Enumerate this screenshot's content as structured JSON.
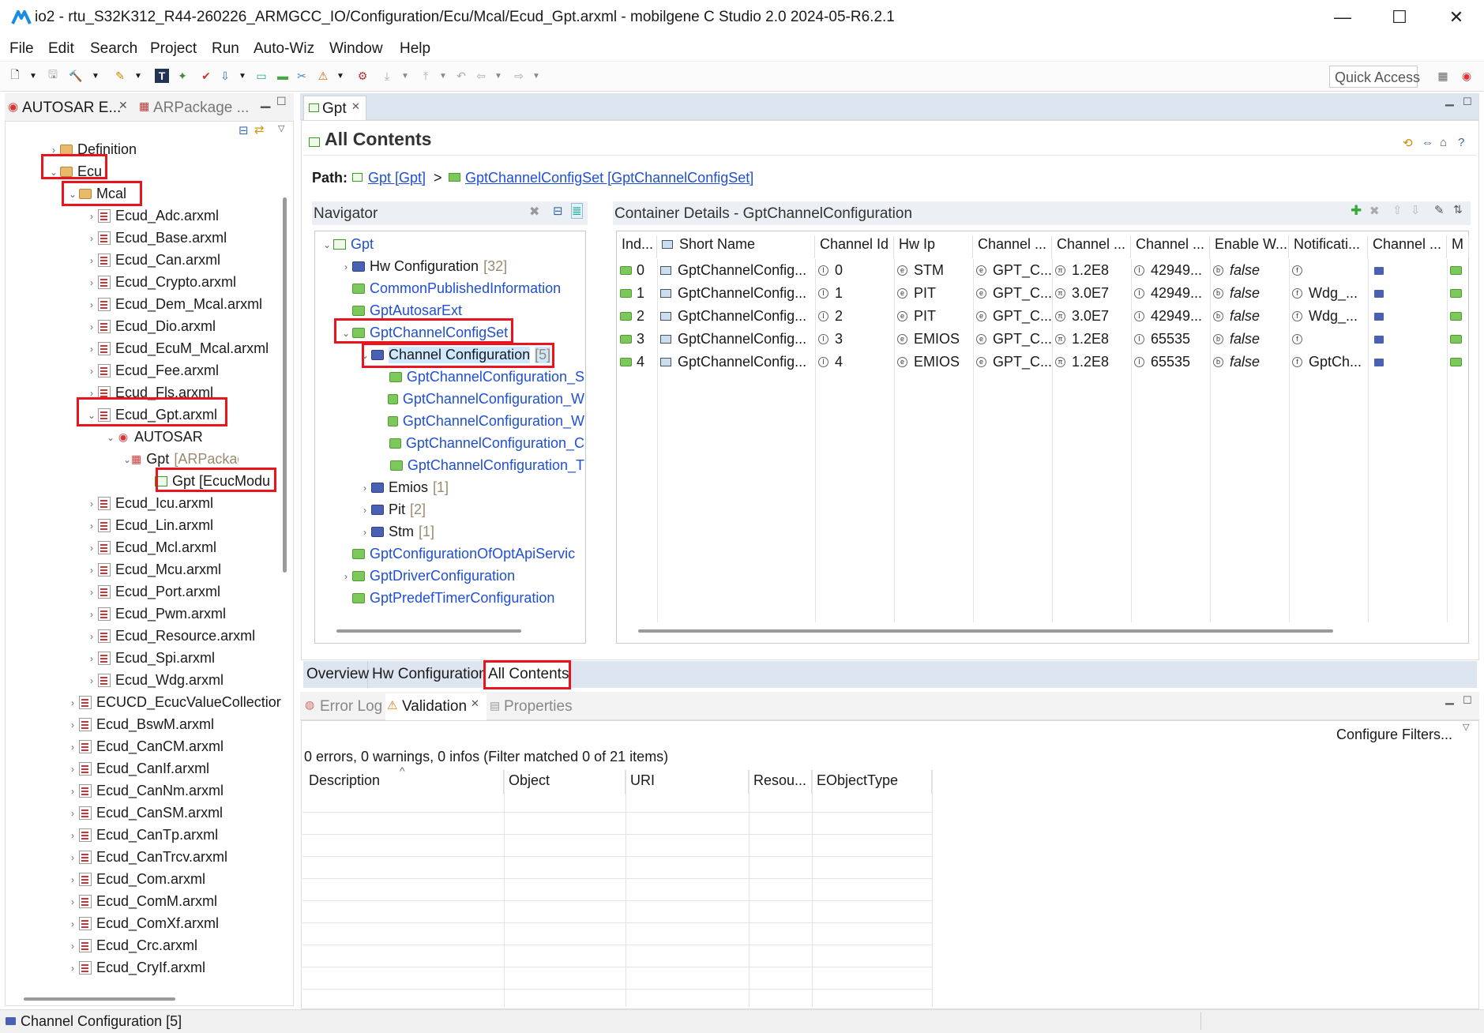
{
  "window": {
    "title": "io2 - rtu_S32K312_R44-260226_ARMGCC_IO/Configuration/Ecu/Mcal/Ecud_Gpt.arxml - mobilgene C Studio 2.0 2024-05-R6.2.1",
    "minimize": "—",
    "maximize": "☐",
    "close": "✕"
  },
  "menu": [
    "File",
    "Edit",
    "Search",
    "Project",
    "Run",
    "Auto-Wiz",
    "Window",
    "Help"
  ],
  "quick_access": "Quick Access",
  "left_panel": {
    "tab_active": "AUTOSAR E...",
    "tab_inactive": "ARPackage ...",
    "tree": [
      {
        "label": "Definition",
        "icon": "folder-icon",
        "depth": 2,
        "twisty": "›"
      },
      {
        "label": "Ecu",
        "icon": "folder-icon",
        "depth": 2,
        "twisty": "⌄"
      },
      {
        "label": "Mcal",
        "icon": "folder-icon",
        "depth": 3,
        "twisty": "⌄"
      },
      {
        "label": "Ecud_Adc.arxml",
        "icon": "file-icon",
        "depth": 4,
        "twisty": "›"
      },
      {
        "label": "Ecud_Base.arxml",
        "icon": "file-icon",
        "depth": 4,
        "twisty": "›"
      },
      {
        "label": "Ecud_Can.arxml",
        "icon": "file-icon",
        "depth": 4,
        "twisty": "›"
      },
      {
        "label": "Ecud_Crypto.arxml",
        "icon": "file-icon",
        "depth": 4,
        "twisty": "›"
      },
      {
        "label": "Ecud_Dem_Mcal.arxml",
        "icon": "file-icon",
        "depth": 4,
        "twisty": "›"
      },
      {
        "label": "Ecud_Dio.arxml",
        "icon": "file-icon",
        "depth": 4,
        "twisty": "›"
      },
      {
        "label": "Ecud_EcuM_Mcal.arxml",
        "icon": "file-icon",
        "depth": 4,
        "twisty": "›"
      },
      {
        "label": "Ecud_Fee.arxml",
        "icon": "file-icon",
        "depth": 4,
        "twisty": "›"
      },
      {
        "label": "Ecud_Fls.arxml",
        "icon": "file-icon",
        "depth": 4,
        "twisty": "›"
      },
      {
        "label": "Ecud_Gpt.arxml",
        "icon": "file-icon",
        "depth": 4,
        "twisty": "⌄"
      },
      {
        "label": "AUTOSAR",
        "icon": "autosar-icon",
        "depth": 5,
        "twisty": "⌄"
      },
      {
        "label": "Gpt",
        "suffix": "[ARPackage]",
        "icon": "package-icon",
        "depth": 6,
        "twisty": "⌄"
      },
      {
        "label": "Gpt [EcucModu",
        "icon": "module-icon",
        "depth": 7,
        "twisty": ""
      },
      {
        "label": "Ecud_Icu.arxml",
        "icon": "file-icon",
        "depth": 4,
        "twisty": "›"
      },
      {
        "label": "Ecud_Lin.arxml",
        "icon": "file-icon",
        "depth": 4,
        "twisty": "›"
      },
      {
        "label": "Ecud_Mcl.arxml",
        "icon": "file-icon",
        "depth": 4,
        "twisty": "›"
      },
      {
        "label": "Ecud_Mcu.arxml",
        "icon": "file-icon",
        "depth": 4,
        "twisty": "›"
      },
      {
        "label": "Ecud_Port.arxml",
        "icon": "file-icon",
        "depth": 4,
        "twisty": "›"
      },
      {
        "label": "Ecud_Pwm.arxml",
        "icon": "file-icon",
        "depth": 4,
        "twisty": "›"
      },
      {
        "label": "Ecud_Resource.arxml",
        "icon": "file-icon",
        "depth": 4,
        "twisty": "›"
      },
      {
        "label": "Ecud_Spi.arxml",
        "icon": "file-icon",
        "depth": 4,
        "twisty": "›"
      },
      {
        "label": "Ecud_Wdg.arxml",
        "icon": "file-icon",
        "depth": 4,
        "twisty": "›"
      },
      {
        "label": "ECUCD_EcucValueCollectior",
        "icon": "file-icon",
        "depth": 3,
        "twisty": "›"
      },
      {
        "label": "Ecud_BswM.arxml",
        "icon": "file-icon",
        "depth": 3,
        "twisty": "›"
      },
      {
        "label": "Ecud_CanCM.arxml",
        "icon": "file-icon",
        "depth": 3,
        "twisty": "›"
      },
      {
        "label": "Ecud_CanIf.arxml",
        "icon": "file-icon",
        "depth": 3,
        "twisty": "›"
      },
      {
        "label": "Ecud_CanNm.arxml",
        "icon": "file-icon",
        "depth": 3,
        "twisty": "›"
      },
      {
        "label": "Ecud_CanSM.arxml",
        "icon": "file-icon",
        "depth": 3,
        "twisty": "›"
      },
      {
        "label": "Ecud_CanTp.arxml",
        "icon": "file-icon",
        "depth": 3,
        "twisty": "›"
      },
      {
        "label": "Ecud_CanTrcv.arxml",
        "icon": "file-icon",
        "depth": 3,
        "twisty": "›"
      },
      {
        "label": "Ecud_Com.arxml",
        "icon": "file-icon",
        "depth": 3,
        "twisty": "›"
      },
      {
        "label": "Ecud_ComM.arxml",
        "icon": "file-icon",
        "depth": 3,
        "twisty": "›"
      },
      {
        "label": "Ecud_ComXf.arxml",
        "icon": "file-icon",
        "depth": 3,
        "twisty": "›"
      },
      {
        "label": "Ecud_Crc.arxml",
        "icon": "file-icon",
        "depth": 3,
        "twisty": "›"
      },
      {
        "label": "Ecud_CryIf.arxml",
        "icon": "file-icon",
        "depth": 3,
        "twisty": "›"
      }
    ]
  },
  "editor": {
    "tab": "Gpt",
    "heading": "All Contents",
    "path_label": "Path:",
    "path_1": "Gpt [Gpt]",
    "path_sep": ">",
    "path_2": "GptChannelConfigSet [GptChannelConfigSet]",
    "navigator_title": "Navigator",
    "nav_tree": [
      {
        "label": "Gpt",
        "icon": "module-icon",
        "depth": 0,
        "twisty": "⌄",
        "link": true
      },
      {
        "label": "Hw Configuration",
        "count": "[32]",
        "icon": "blue-folder-icon",
        "depth": 1,
        "twisty": "›",
        "link": false
      },
      {
        "label": "CommonPublishedInformation",
        "icon": "green-folder-icon",
        "depth": 1,
        "twisty": "",
        "link": true
      },
      {
        "label": "GptAutosarExt",
        "icon": "green-folder-icon",
        "depth": 1,
        "twisty": "",
        "link": true
      },
      {
        "label": "GptChannelConfigSet",
        "icon": "green-folder-icon",
        "depth": 1,
        "twisty": "⌄",
        "link": true
      },
      {
        "label": "Channel Configuration",
        "count": "[5]",
        "icon": "blue-folder-icon",
        "depth": 2,
        "twisty": "⌄",
        "link": false,
        "selected": true
      },
      {
        "label": "GptChannelConfiguration_S",
        "icon": "green-folder-icon",
        "depth": 3,
        "twisty": "",
        "link": true
      },
      {
        "label": "GptChannelConfiguration_W",
        "icon": "green-folder-icon",
        "depth": 3,
        "twisty": "",
        "link": true
      },
      {
        "label": "GptChannelConfiguration_W",
        "icon": "green-folder-icon",
        "depth": 3,
        "twisty": "",
        "link": true
      },
      {
        "label": "GptChannelConfiguration_C",
        "icon": "green-folder-icon",
        "depth": 3,
        "twisty": "",
        "link": true
      },
      {
        "label": "GptChannelConfiguration_T",
        "icon": "green-folder-icon",
        "depth": 3,
        "twisty": "",
        "link": true
      },
      {
        "label": "Emios",
        "count": "[1]",
        "icon": "blue-folder-icon",
        "depth": 2,
        "twisty": "›",
        "link": false
      },
      {
        "label": "Pit",
        "count": "[2]",
        "icon": "blue-folder-icon",
        "depth": 2,
        "twisty": "›",
        "link": false
      },
      {
        "label": "Stm",
        "count": "[1]",
        "icon": "blue-folder-icon",
        "depth": 2,
        "twisty": "›",
        "link": false
      },
      {
        "label": "GptConfigurationOfOptApiServic",
        "icon": "green-folder-icon",
        "depth": 1,
        "twisty": "",
        "link": true
      },
      {
        "label": "GptDriverConfiguration",
        "icon": "green-folder-icon",
        "depth": 1,
        "twisty": "›",
        "link": true
      },
      {
        "label": "GptPredefTimerConfiguration",
        "icon": "green-folder-icon",
        "depth": 1,
        "twisty": "",
        "link": true
      }
    ],
    "details_title": "Container Details - GptChannelConfiguration",
    "columns": [
      "Ind...",
      "Short Name",
      "Channel Id",
      "Hw Ip",
      "Channel ...",
      "Channel ...",
      "Channel ...",
      "Enable W...",
      "Notificati...",
      "Channel ...",
      "M"
    ],
    "rows": [
      [
        "0",
        "GptChannelConfig...",
        "0",
        "STM",
        "GPT_C...",
        "1.2E8",
        "42949...",
        "false",
        "",
        "",
        ""
      ],
      [
        "1",
        "GptChannelConfig...",
        "1",
        "PIT",
        "GPT_C...",
        "3.0E7",
        "42949...",
        "false",
        "Wdg_...",
        "",
        ""
      ],
      [
        "2",
        "GptChannelConfig...",
        "2",
        "PIT",
        "GPT_C...",
        "3.0E7",
        "42949...",
        "false",
        "Wdg_...",
        "",
        ""
      ],
      [
        "3",
        "GptChannelConfig...",
        "3",
        "EMIOS",
        "GPT_C...",
        "1.2E8",
        "65535",
        "false",
        "",
        "",
        ""
      ],
      [
        "4",
        "GptChannelConfig...",
        "4",
        "EMIOS",
        "GPT_C...",
        "1.2E8",
        "65535",
        "false",
        "GptCh...",
        "",
        ""
      ]
    ],
    "bottom_tabs": [
      "Overview",
      "Hw Configuration",
      "All Contents"
    ]
  },
  "console": {
    "tabs": [
      "Error Log",
      "Validation",
      "Properties"
    ],
    "configure_filters": "Configure Filters...",
    "summary": "0 errors, 0 warnings, 0 infos (Filter matched 0 of 21 items)",
    "columns": [
      "Description",
      "Object",
      "URI",
      "Resou...",
      "EObjectType"
    ]
  },
  "status_bar": {
    "text": "Channel Configuration [5]"
  },
  "colors": {
    "annotation_red": "#e8141e",
    "link_blue": "#1f4fd6",
    "selection": "#cde8ff",
    "folder_green": "#7cc85a"
  }
}
